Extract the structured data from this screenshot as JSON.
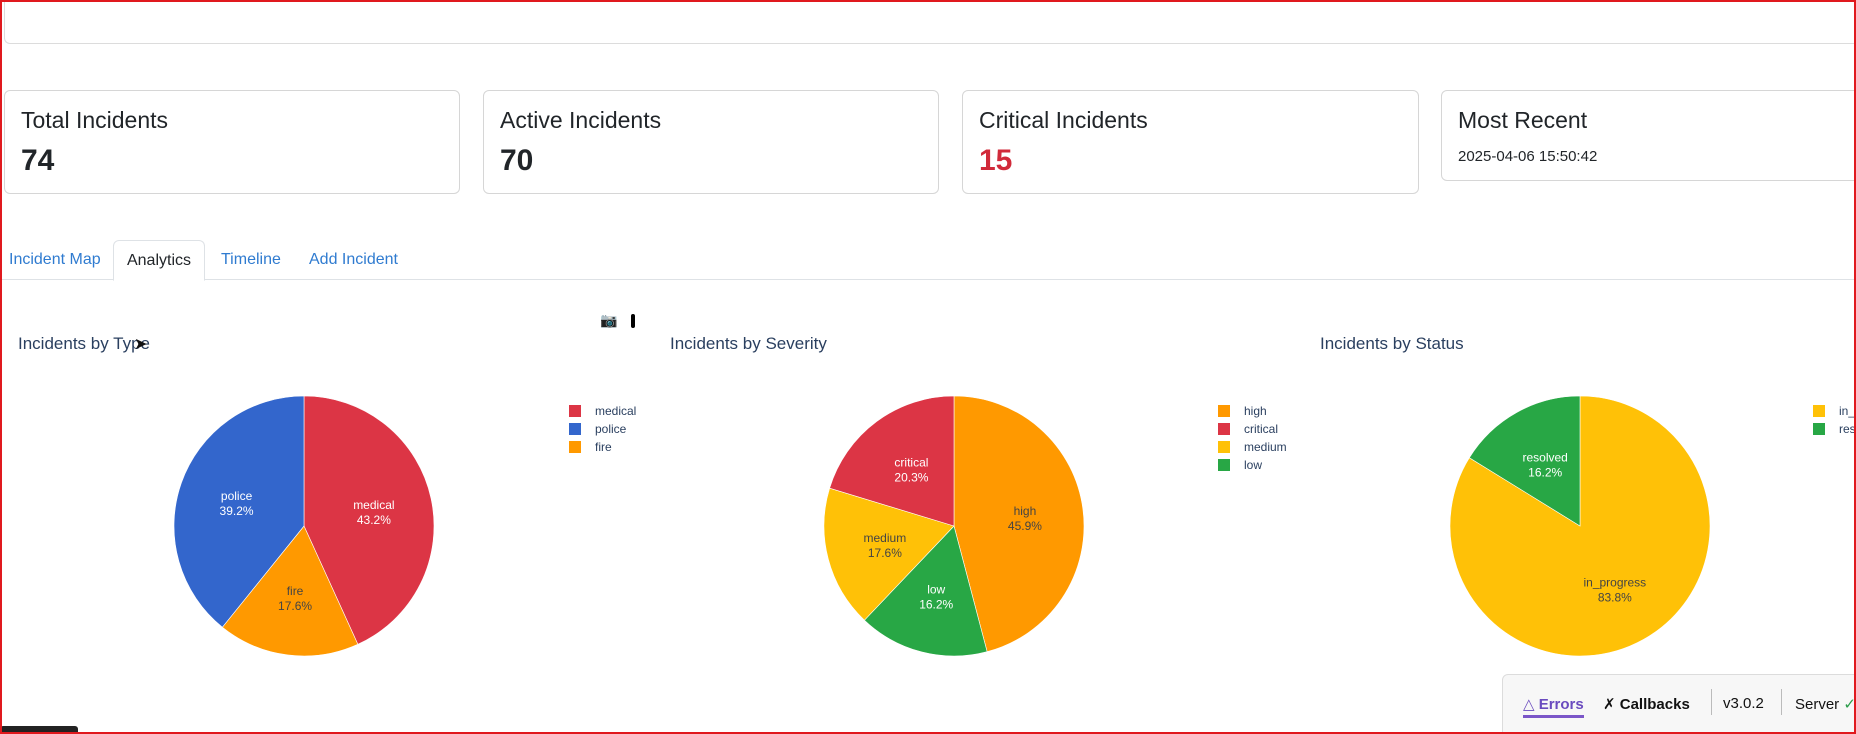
{
  "cards": [
    {
      "title": "Total Incidents",
      "value": "74"
    },
    {
      "title": "Active Incidents",
      "value": "70"
    },
    {
      "title": "Critical Incidents",
      "value": "15"
    },
    {
      "title": "Most Recent",
      "value": "2025-04-06 15:50:42"
    }
  ],
  "tabs": [
    "Incident Map",
    "Analytics",
    "Timeline",
    "Add Incident"
  ],
  "active_tab": "Analytics",
  "colors": {
    "red": "#dc3545",
    "blue": "#3366cc",
    "orange": "#ff9900",
    "yellow": "#ffc107",
    "green": "#28a745",
    "critical_text": "#d12a3a",
    "link": "#2f7bd0"
  },
  "icons": [
    "camera-icon",
    "cursor-icon",
    "warning-triangle-icon",
    "callbacks-icon",
    "check-circle-icon"
  ],
  "debug_bar": {
    "errors": "Errors",
    "callbacks": "Callbacks",
    "version": "v3.0.2",
    "server": "Server"
  },
  "chart_data": [
    {
      "type": "pie",
      "title": "Incidents by Type",
      "labels": [
        "medical",
        "police",
        "fire"
      ],
      "values": [
        43.2,
        39.2,
        17.6
      ],
      "display": [
        "43.2%",
        "39.2%",
        "17.6%"
      ],
      "colors": [
        "#dc3545",
        "#3366cc",
        "#ff9900"
      ],
      "slice_order": [
        "medical",
        "fire",
        "police"
      ],
      "legend": "right"
    },
    {
      "type": "pie",
      "title": "Incidents by Severity",
      "labels": [
        "high",
        "critical",
        "medium",
        "low"
      ],
      "values": [
        45.9,
        20.3,
        17.6,
        16.2
      ],
      "display": [
        "45.9%",
        "20.3%",
        "17.6%",
        "16.2%"
      ],
      "colors": [
        "#ff9900",
        "#dc3545",
        "#ffc107",
        "#28a745"
      ],
      "slice_order": [
        "high",
        "low",
        "medium",
        "critical"
      ],
      "legend": "right"
    },
    {
      "type": "pie",
      "title": "Incidents by Status",
      "labels": [
        "in_progress",
        "resolved"
      ],
      "legend_labels": [
        "in_",
        "res"
      ],
      "values": [
        83.8,
        16.2
      ],
      "display": [
        "83.8%",
        "16.2%"
      ],
      "colors": [
        "#ffc107",
        "#28a745"
      ],
      "slice_order": [
        "in_progress",
        "resolved"
      ],
      "legend": "right"
    }
  ]
}
